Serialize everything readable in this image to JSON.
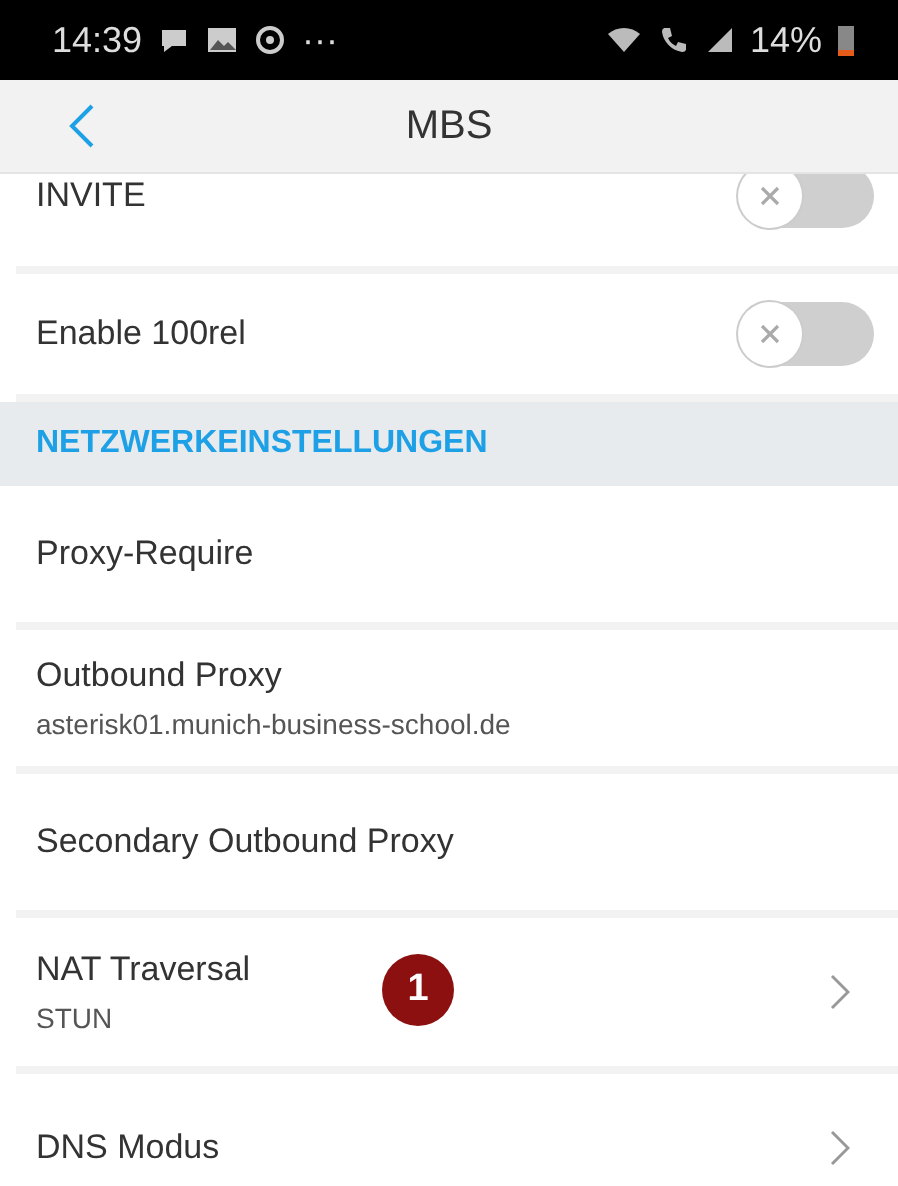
{
  "status_bar": {
    "time": "14:39",
    "more": "···",
    "battery": "14%"
  },
  "nav": {
    "title": "MBS"
  },
  "rows": [
    {
      "kind": "toggle",
      "label": "INVITE",
      "on": false
    },
    {
      "kind": "toggle",
      "label": "Enable 100rel",
      "on": false
    },
    {
      "kind": "header",
      "label": "NETZWERKEINSTELLUNGEN"
    },
    {
      "kind": "item",
      "label": "Proxy-Require"
    },
    {
      "kind": "item",
      "label": "Outbound Proxy",
      "value": "asterisk01.munich-business-school.de"
    },
    {
      "kind": "item",
      "label": "Secondary Outbound Proxy"
    },
    {
      "kind": "link",
      "label": "NAT Traversal",
      "value": "STUN",
      "badge": "1"
    },
    {
      "kind": "link",
      "label": "DNS Modus"
    }
  ]
}
